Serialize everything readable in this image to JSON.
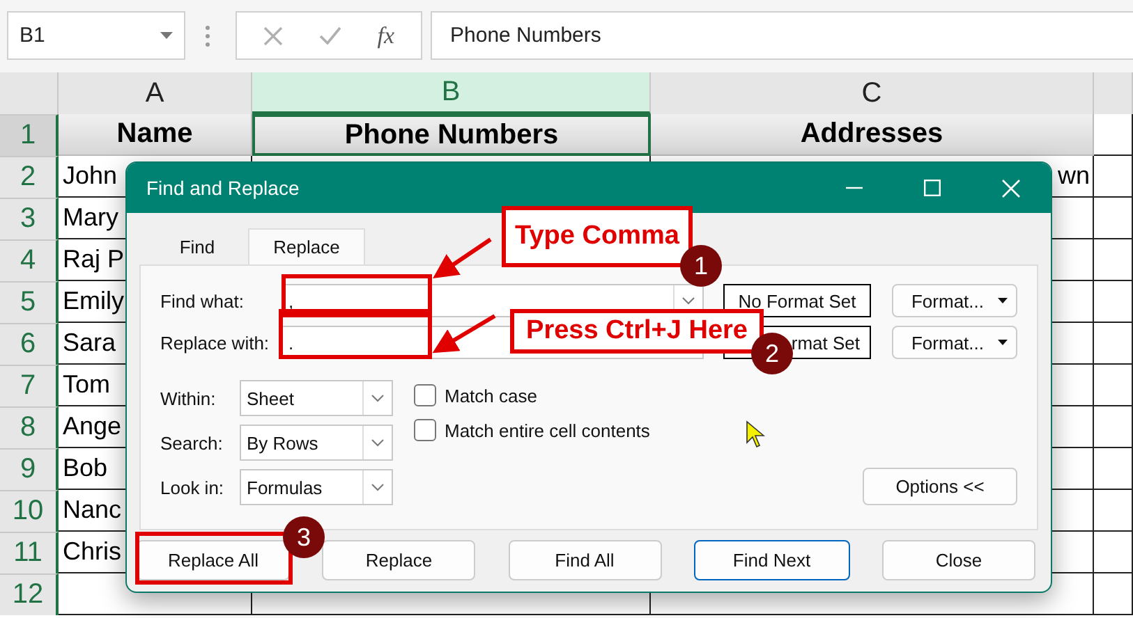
{
  "name_box": "B1",
  "function_label": "fx",
  "formula": "Phone Numbers",
  "columns": [
    {
      "label": "A",
      "selected": false
    },
    {
      "label": "B",
      "selected": true
    },
    {
      "label": "C",
      "selected": false
    }
  ],
  "rows": [
    {
      "number": "1",
      "selected": true,
      "kind": "header",
      "cells": {
        "A": "Name",
        "B": "Phone Numbers",
        "C": "Addresses"
      }
    },
    {
      "number": "2",
      "selected": false,
      "kind": "data",
      "cells": {
        "A": "John",
        "C": "wn"
      }
    },
    {
      "number": "3",
      "selected": false,
      "kind": "data",
      "cells": {
        "A": "Mary"
      }
    },
    {
      "number": "4",
      "selected": false,
      "kind": "data",
      "cells": {
        "A": "Raj P"
      }
    },
    {
      "number": "5",
      "selected": false,
      "kind": "data",
      "cells": {
        "A": "Emily"
      }
    },
    {
      "number": "6",
      "selected": false,
      "kind": "data",
      "cells": {
        "A": "Sara"
      }
    },
    {
      "number": "7",
      "selected": false,
      "kind": "data",
      "cells": {
        "A": "Tom"
      }
    },
    {
      "number": "8",
      "selected": false,
      "kind": "data",
      "cells": {
        "A": "Ange"
      }
    },
    {
      "number": "9",
      "selected": false,
      "kind": "data",
      "cells": {
        "A": "Bob"
      }
    },
    {
      "number": "10",
      "selected": false,
      "kind": "data",
      "cells": {
        "A": "Nanc"
      }
    },
    {
      "number": "11",
      "selected": false,
      "kind": "data",
      "cells": {
        "A": "Chris"
      }
    },
    {
      "number": "12",
      "selected": false,
      "kind": "data",
      "cells": {}
    }
  ],
  "dialog": {
    "title": "Find and Replace",
    "tabs": [
      {
        "label": "Find",
        "selected": false
      },
      {
        "label": "Replace",
        "selected": true
      }
    ],
    "fields": [
      {
        "label": "Find what:",
        "value": ",",
        "dropdown": true,
        "format": "No Format Set",
        "format_button": "Format..."
      },
      {
        "label": "Replace with:",
        "value": ".",
        "dropdown": false,
        "format": "rmat Set",
        "format_button": "Format..."
      }
    ],
    "options": [
      {
        "label": "Within:",
        "value": "Sheet"
      },
      {
        "label": "Search:",
        "value": "By Rows"
      },
      {
        "label": "Look in:",
        "value": "Formulas"
      }
    ],
    "checkboxes": [
      {
        "label": "Match case",
        "checked": false
      },
      {
        "label": "Match entire cell contents",
        "checked": false
      }
    ],
    "options_button": "Options <<",
    "buttons": [
      {
        "label": "Replace All",
        "focused": false
      },
      {
        "label": "Replace",
        "focused": false
      },
      {
        "label": "Find All",
        "focused": false
      },
      {
        "label": "Find Next",
        "focused": true
      },
      {
        "label": "Close",
        "focused": false
      }
    ]
  },
  "annotations": {
    "callouts": [
      "Type Comma",
      "Press Ctrl+J Here"
    ],
    "steps": [
      "1",
      "2",
      "3"
    ]
  }
}
